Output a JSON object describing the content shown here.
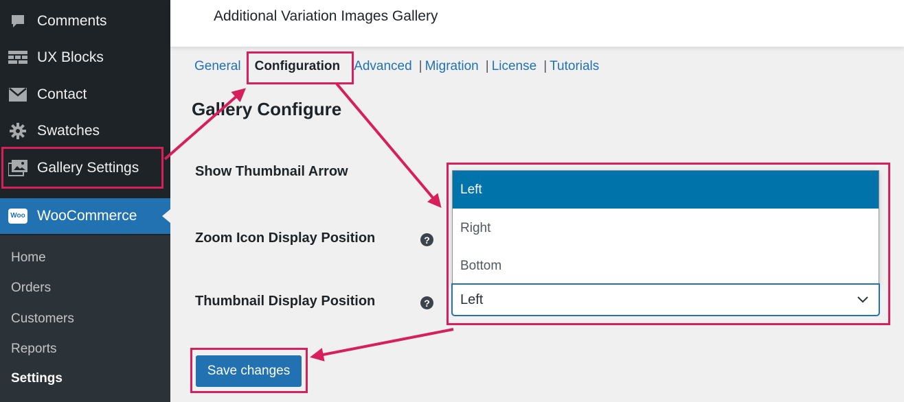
{
  "sidebar": {
    "menu": [
      {
        "label": "Comments",
        "icon": "comment-icon"
      },
      {
        "label": "UX Blocks",
        "icon": "blocks-icon"
      },
      {
        "label": "Contact",
        "icon": "envelope-icon"
      },
      {
        "label": "Swatches",
        "icon": "gear-icon"
      },
      {
        "label": "Gallery Settings",
        "icon": "gallery-icon"
      },
      {
        "label": "WooCommerce",
        "icon": "woo-icon",
        "icon_text": "Woo"
      }
    ],
    "submenu": [
      "Home",
      "Orders",
      "Customers",
      "Reports",
      "Settings"
    ]
  },
  "header": {
    "title": "Additional Variation Images Gallery"
  },
  "tabs": [
    {
      "label": "General"
    },
    {
      "label": "Configuration"
    },
    {
      "label": "Advanced"
    },
    {
      "label": "Migration"
    },
    {
      "label": "License"
    },
    {
      "label": "Tutorials"
    }
  ],
  "tab_separator": "|",
  "section_title": "Gallery Configure",
  "fields": [
    {
      "label": "Show Thumbnail Arrow"
    },
    {
      "label": "Zoom Icon Display Position",
      "help": "?"
    },
    {
      "label": "Thumbnail Display Position",
      "help": "?"
    }
  ],
  "dropdown": {
    "value": "Left",
    "options": [
      "Left",
      "Right",
      "Bottom"
    ],
    "highlighted_option": "Left"
  },
  "save_button": "Save changes",
  "colors": {
    "accent": "#2271b1",
    "annotation": "#d61f5b",
    "sidebar": "#1d2327"
  }
}
